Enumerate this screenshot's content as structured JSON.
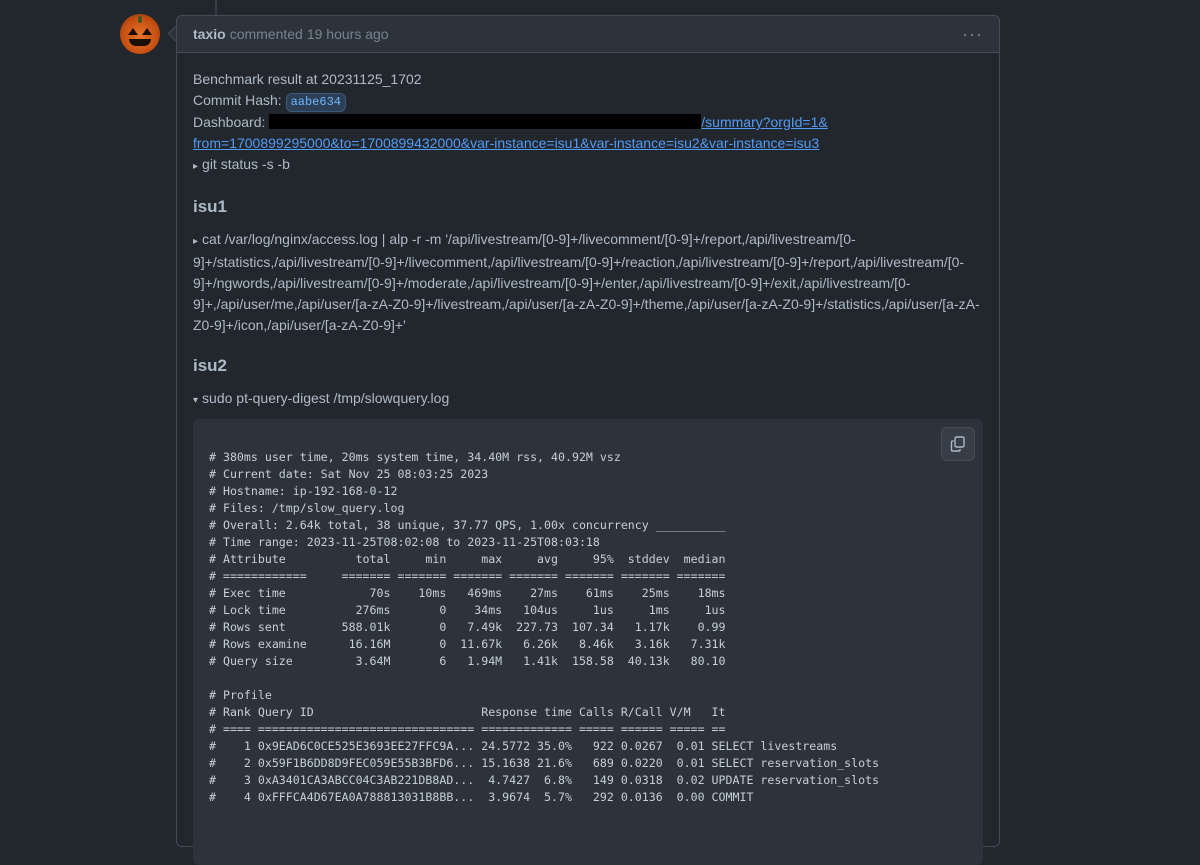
{
  "comment": {
    "author": "taxio",
    "action": "commented",
    "time": "19 hours ago",
    "menu_label": "···"
  },
  "body": {
    "benchmark_line": "Benchmark result at 20231125_1702",
    "commit_label": "Commit Hash:",
    "commit_hash": "aabe634",
    "dashboard_label": "Dashboard:",
    "dashboard_link_tail": "/summary?orgId=1&",
    "dashboard_link_line2": "from=1700899295000&to=1700899432000&var-instance=isu1&var-instance=isu2&var-instance=isu3",
    "git_status_summary": "git status -s -b",
    "isu1_heading": "isu1",
    "alp_summary": "cat /var/log/nginx/access.log | alp -r -m '/api/livestream/[0-9]+/livecomment/[0-9]+/report,/api/livestream/[0-9]+/statistics,/api/livestream/[0-9]+/livecomment,/api/livestream/[0-9]+/reaction,/api/livestream/[0-9]+/report,/api/livestream/[0-9]+/ngwords,/api/livestream/[0-9]+/moderate,/api/livestream/[0-9]+/enter,/api/livestream/[0-9]+/exit,/api/livestream/[0-9]+,/api/user/me,/api/user/[a-zA-Z0-9]+/livestream,/api/user/[a-zA-Z0-9]+/theme,/api/user/[a-zA-Z0-9]+/statistics,/api/user/[a-zA-Z0-9]+/icon,/api/user/[a-zA-Z0-9]+'",
    "isu2_heading": "isu2",
    "slowquery_summary": "sudo pt-query-digest /tmp/slowquery.log",
    "collapsed_marker": "▸",
    "expanded_marker": "▾"
  },
  "code": {
    "lines": [
      "# 380ms user time, 20ms system time, 34.40M rss, 40.92M vsz",
      "# Current date: Sat Nov 25 08:03:25 2023",
      "# Hostname: ip-192-168-0-12",
      "# Files: /tmp/slow_query.log",
      "# Overall: 2.64k total, 38 unique, 37.77 QPS, 1.00x concurrency __________",
      "# Time range: 2023-11-25T08:02:08 to 2023-11-25T08:03:18",
      "# Attribute          total     min     max     avg     95%  stddev  median",
      "# ============     ======= ======= ======= ======= ======= ======= =======",
      "# Exec time            70s    10ms   469ms    27ms    61ms    25ms    18ms",
      "# Lock time          276ms       0    34ms   104us     1us     1ms     1us",
      "# Rows sent        588.01k       0   7.49k  227.73  107.34   1.17k    0.99",
      "# Rows examine      16.16M       0  11.67k   6.26k   8.46k   3.16k   7.31k",
      "# Query size         3.64M       6   1.94M   1.41k  158.58  40.13k   80.10",
      "",
      "# Profile",
      "# Rank Query ID                        Response time Calls R/Call V/M   It",
      "# ==== =============================== ============= ===== ====== ===== ==",
      "#    1 0x9EAD6C0CE525E3693EE27FFC9A... 24.5772 35.0%   922 0.0267  0.01 SELECT livestreams",
      "#    2 0x59F1B6DD8D9FEC059E55B3BFD6... 15.1638 21.6%   689 0.0220  0.01 SELECT reservation_slots",
      "#    3 0xA3401CA3ABCC04C3AB221DB8AD...  4.7427  6.8%   149 0.0318  0.02 UPDATE reservation_slots",
      "#    4 0xFFFCA4D67EA0A788813031B8BB...  3.9674  5.7%   292 0.0136  0.00 COMMIT"
    ]
  }
}
